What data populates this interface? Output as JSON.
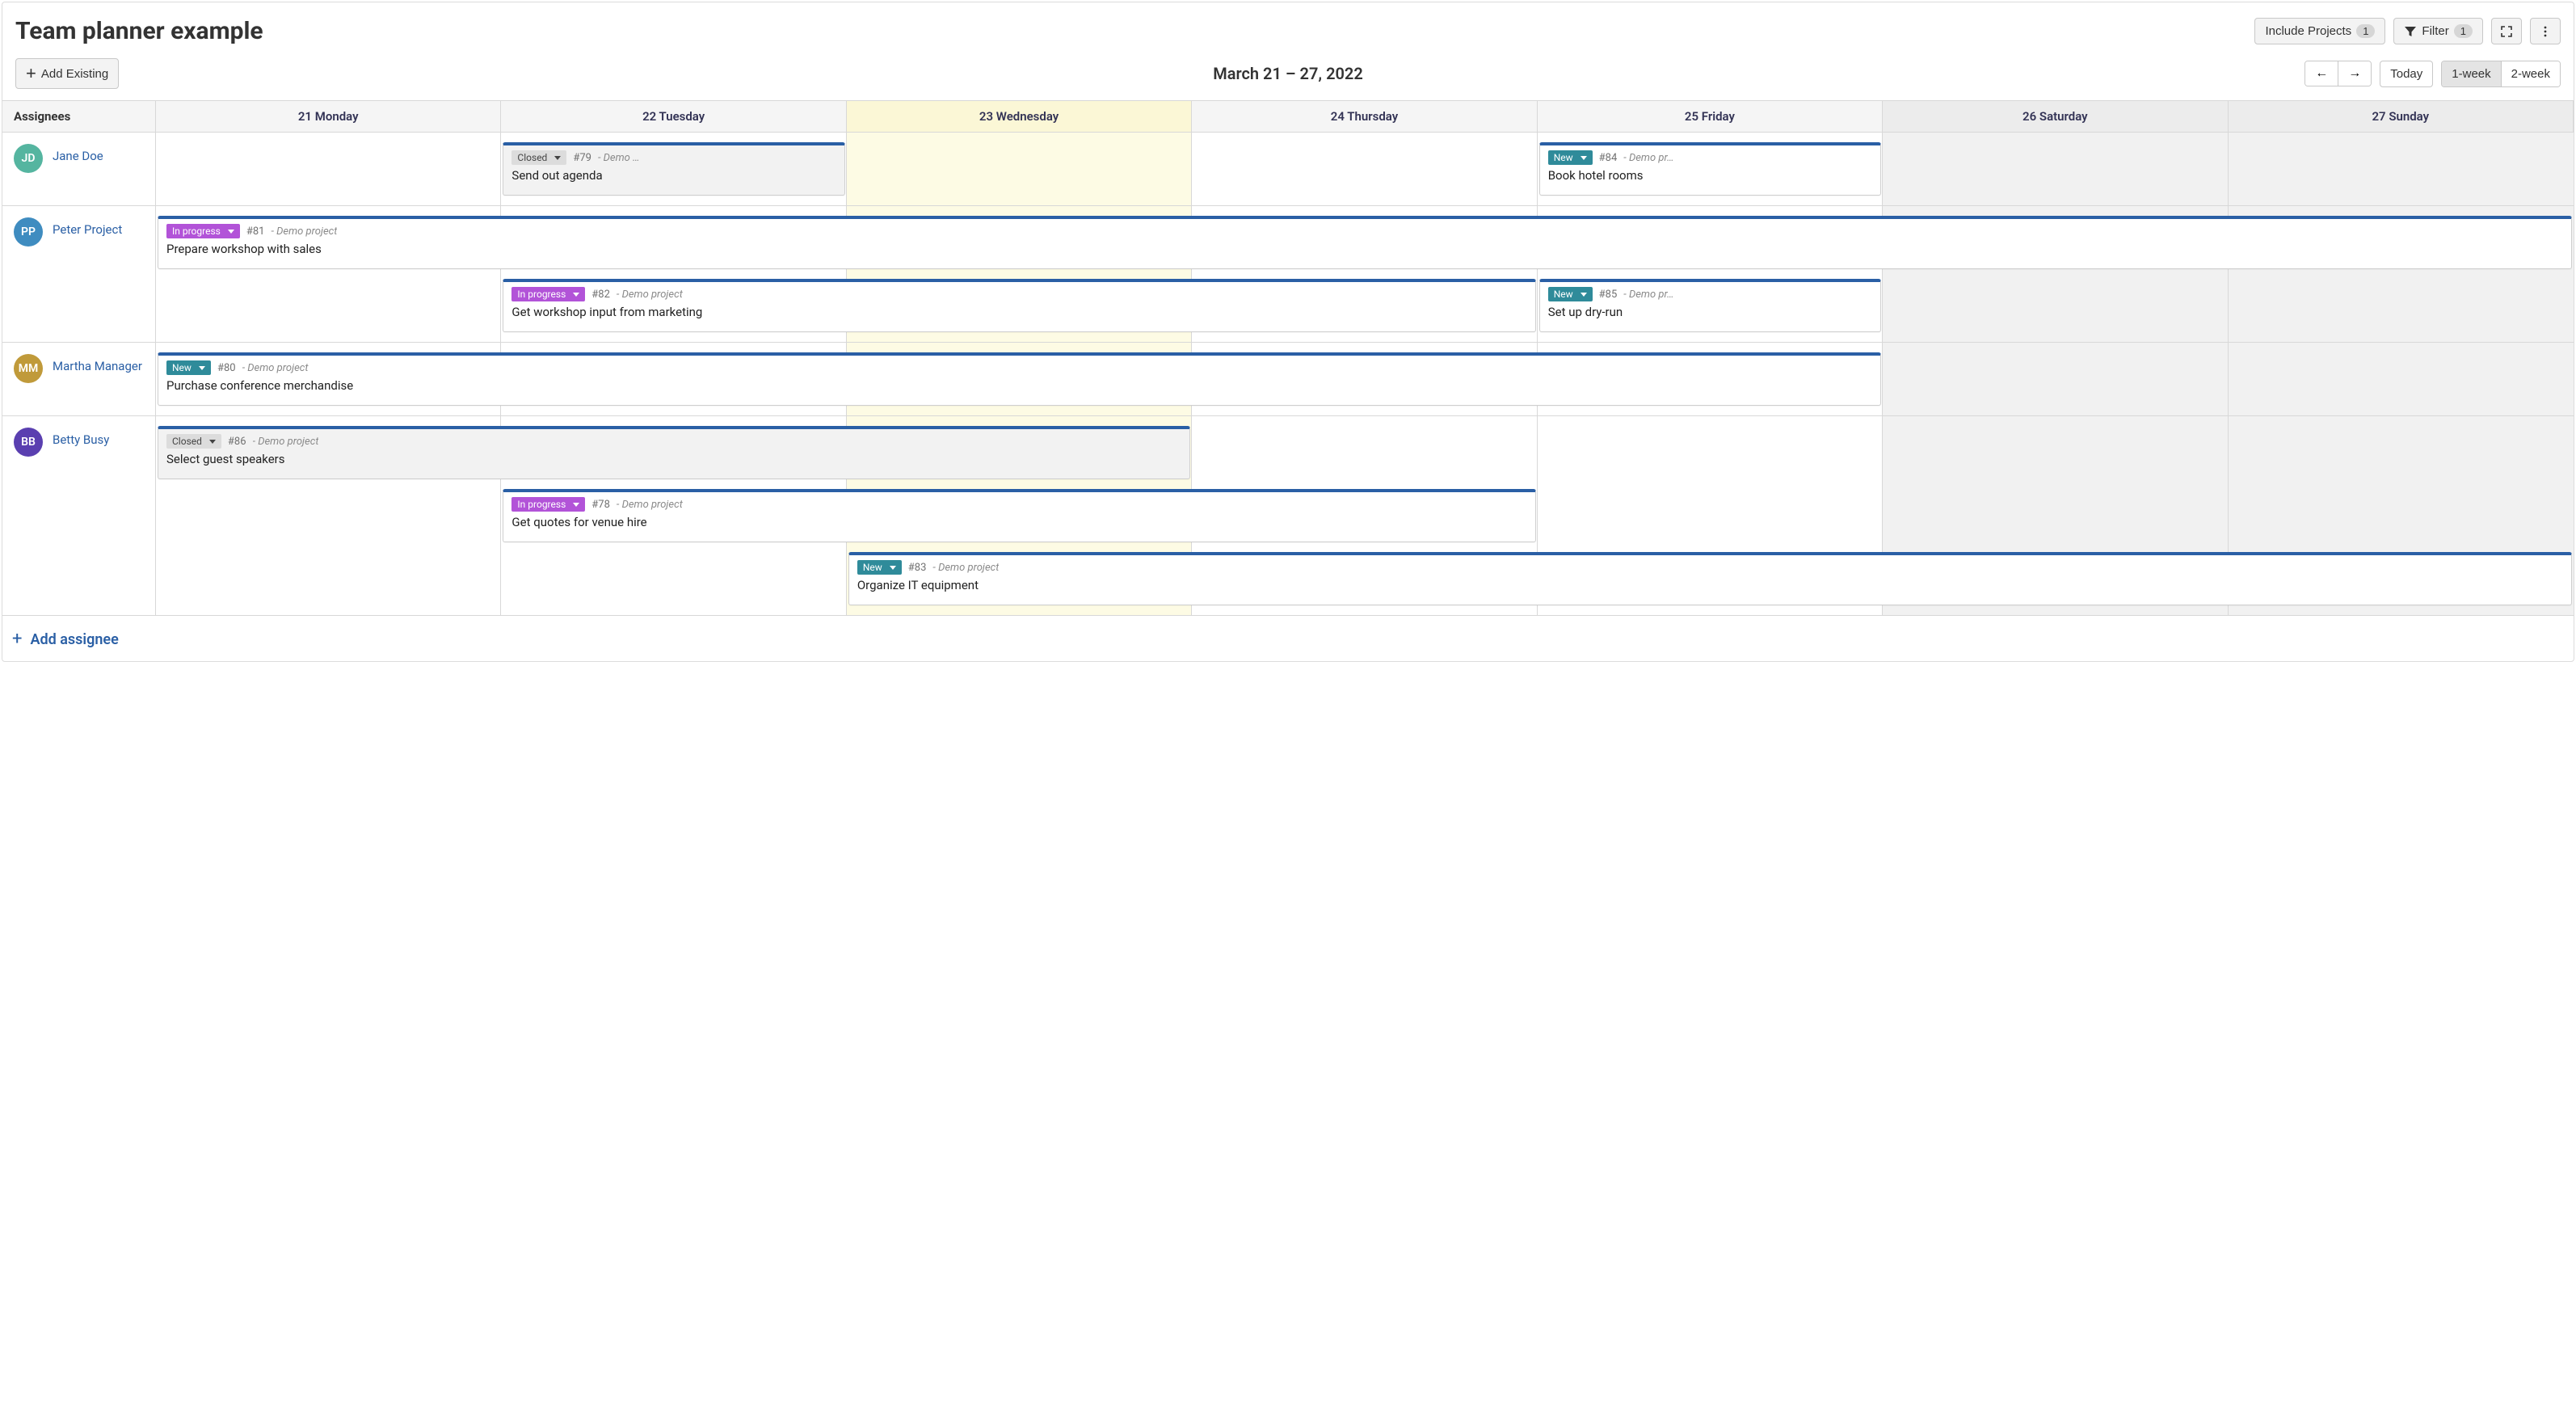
{
  "header": {
    "title": "Team planner example",
    "include_projects_label": "Include Projects",
    "include_projects_count": "1",
    "filter_label": "Filter",
    "filter_count": "1"
  },
  "toolbar": {
    "add_existing_label": "Add Existing",
    "date_range": "March 21 – 27, 2022",
    "today_label": "Today",
    "range_1week": "1-week",
    "range_2week": "2-week"
  },
  "columns": {
    "assignees_header": "Assignees",
    "days": [
      {
        "label": "21 Monday",
        "today": false,
        "weekend": false
      },
      {
        "label": "22 Tuesday",
        "today": false,
        "weekend": false
      },
      {
        "label": "23 Wednesday",
        "today": true,
        "weekend": false
      },
      {
        "label": "24 Thursday",
        "today": false,
        "weekend": false
      },
      {
        "label": "25 Friday",
        "today": false,
        "weekend": false
      },
      {
        "label": "26 Saturday",
        "today": false,
        "weekend": true
      },
      {
        "label": "27 Sunday",
        "today": false,
        "weekend": true
      }
    ]
  },
  "status_labels": {
    "closed": "Closed",
    "progress": "In progress",
    "new": "New"
  },
  "assignees": [
    {
      "initials": "JD",
      "name": "Jane Doe",
      "color": "#55b5a0",
      "tracks": [
        [
          {
            "start": 1,
            "span": 1,
            "status": "closed",
            "id": "#79",
            "project": "- Demo …",
            "project_full": "- Demo project",
            "title": "Send out agenda",
            "closed": true
          },
          {
            "start": 4,
            "span": 1,
            "status": "new",
            "id": "#84",
            "project": "- Demo pr…",
            "project_full": "- Demo project",
            "title": "Book hotel rooms"
          }
        ]
      ]
    },
    {
      "initials": "PP",
      "name": "Peter Project",
      "color": "#3f8cc0",
      "tracks": [
        [
          {
            "start": 0,
            "span": 7,
            "status": "progress",
            "id": "#81",
            "project": "- Demo project",
            "title": "Prepare workshop with sales"
          }
        ],
        [
          {
            "start": 1,
            "span": 3,
            "status": "progress",
            "id": "#82",
            "project": "- Demo project",
            "title": "Get workshop input from marketing"
          },
          {
            "start": 4,
            "span": 1,
            "status": "new",
            "id": "#85",
            "project": "- Demo pr…",
            "project_full": "- Demo project",
            "title": "Set up dry-run"
          }
        ]
      ]
    },
    {
      "initials": "MM",
      "name": "Martha Manager",
      "color": "#c09a3a",
      "tracks": [
        [
          {
            "start": 0,
            "span": 5,
            "status": "new",
            "id": "#80",
            "project": "- Demo project",
            "title": "Purchase conference merchandise"
          }
        ]
      ]
    },
    {
      "initials": "BB",
      "name": "Betty Busy",
      "color": "#5a3fb0",
      "tracks": [
        [
          {
            "start": 0,
            "span": 3,
            "status": "closed",
            "id": "#86",
            "project": "- Demo project",
            "title": "Select guest speakers",
            "closed": true
          }
        ],
        [
          {
            "start": 1,
            "span": 3,
            "status": "progress",
            "id": "#78",
            "project": "- Demo project",
            "title": "Get quotes for venue hire"
          }
        ],
        [
          {
            "start": 2,
            "span": 5,
            "status": "new",
            "id": "#83",
            "project": "- Demo project",
            "title": "Organize IT equipment"
          }
        ]
      ]
    }
  ],
  "footer": {
    "add_assignee_label": "Add assignee"
  }
}
